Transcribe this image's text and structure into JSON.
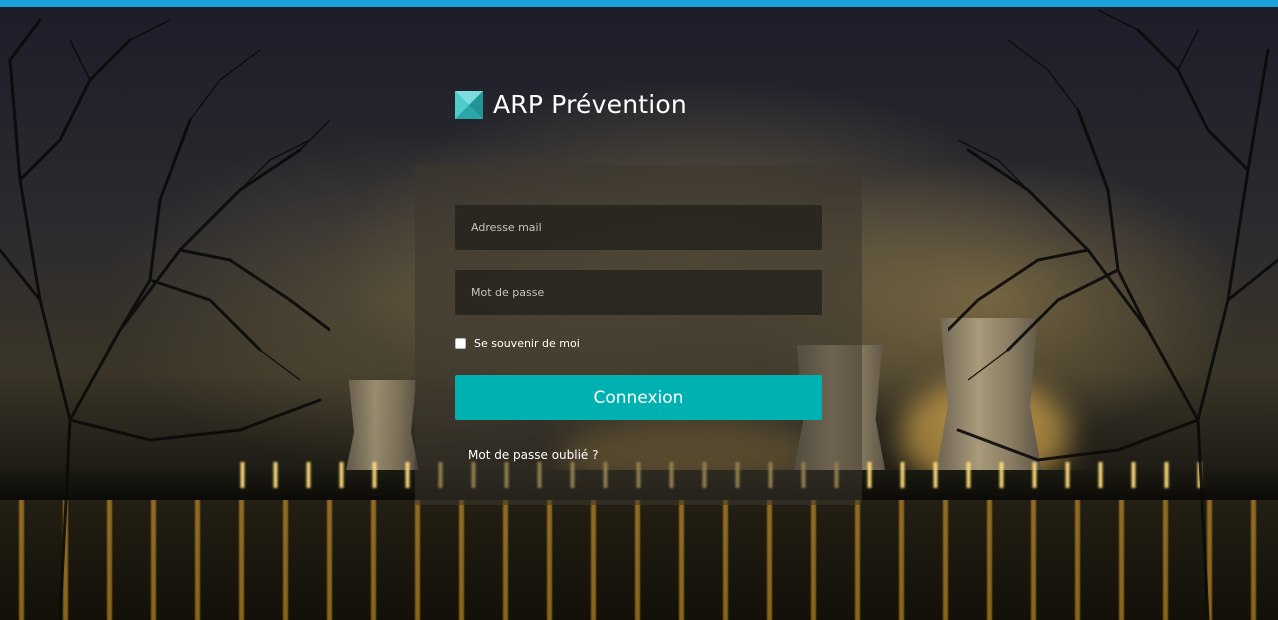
{
  "header": {
    "accent_color": "#1aa3dd"
  },
  "brand": {
    "name": "ARP Prévention",
    "logo_icon": "teal-square-logo-icon",
    "logo_color": "#3cc0c0"
  },
  "login": {
    "email_placeholder": "Adresse mail",
    "email_value": "",
    "password_placeholder": "Mot de passe",
    "password_value": "",
    "remember_label": "Se souvenir de moi",
    "remember_checked": false,
    "submit_label": "Connexion",
    "submit_color": "#00b1b1",
    "forgot_label": "Mot de passe oublié ?"
  }
}
